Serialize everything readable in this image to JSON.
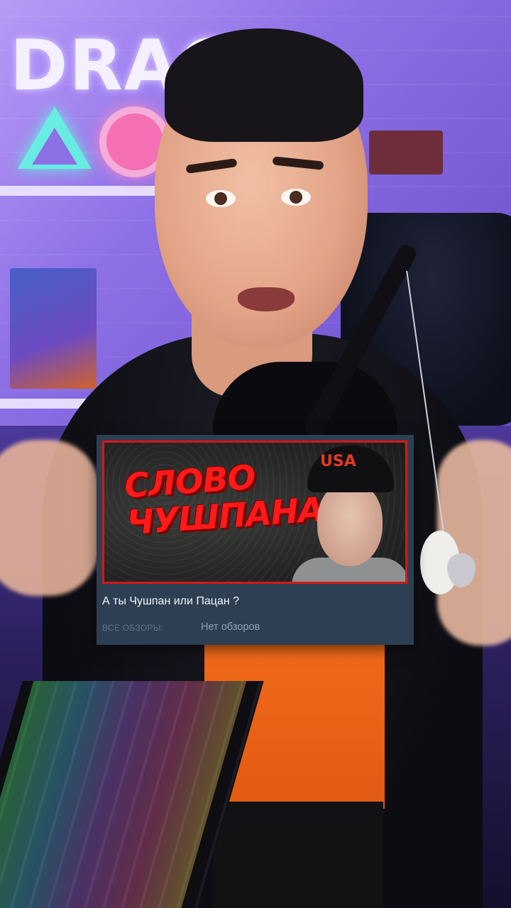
{
  "background": {
    "neon_sign_text": "DRAG"
  },
  "card": {
    "capsule": {
      "title_line1": "СЛОВО",
      "title_line2": "ЧУШПАНА",
      "cap_text": "USA"
    },
    "game_name": "А ты Чушпан или Пацан ?",
    "reviews_label": "ВСЕ ОБЗОРЫ:",
    "reviews_value": "Нет обзоров"
  },
  "colors": {
    "card_bg": "#2d3f52",
    "capsule_border": "#d61818",
    "title_red": "#ff1a1a",
    "label_gray": "#5f7487",
    "value_gray": "#91a3b2"
  }
}
